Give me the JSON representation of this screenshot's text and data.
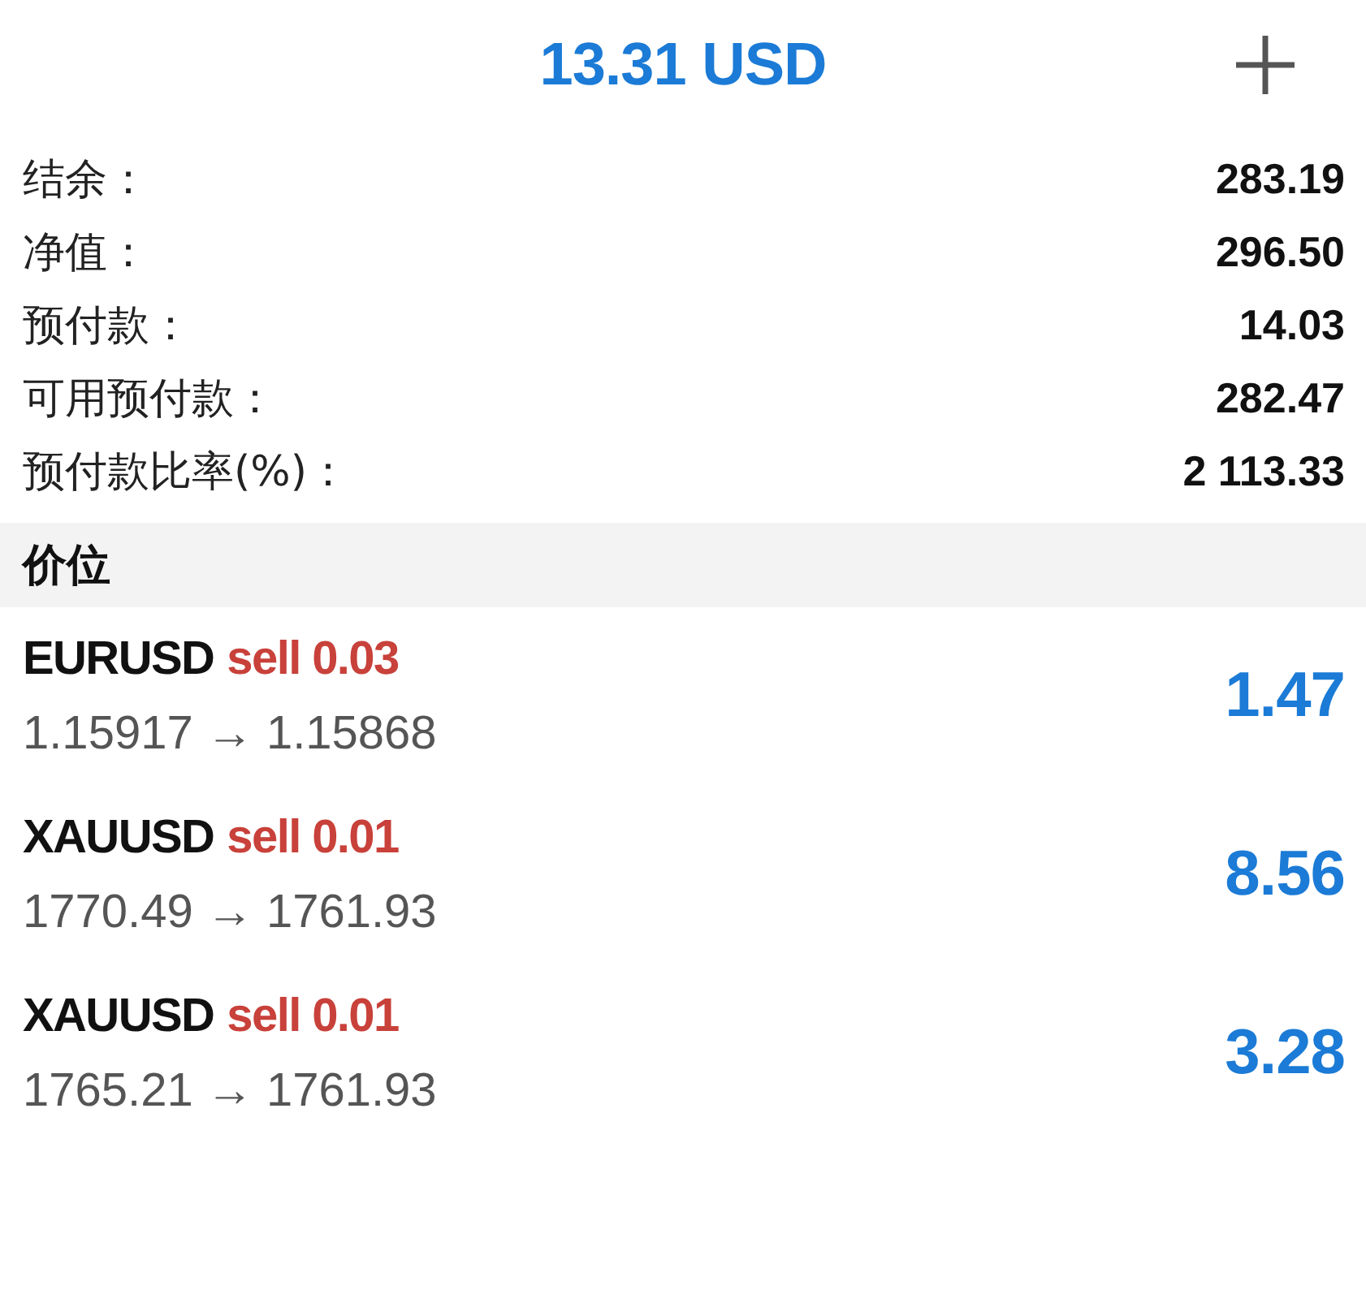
{
  "header": {
    "title": "13.31 USD"
  },
  "summary": [
    {
      "label": "结余：",
      "value": "283.19"
    },
    {
      "label": "净值：",
      "value": "296.50"
    },
    {
      "label": "预付款：",
      "value": "14.03"
    },
    {
      "label": "可用预付款：",
      "value": "282.47"
    },
    {
      "label": "预付款比率(%)：",
      "value": "2 113.33"
    }
  ],
  "positions_section": {
    "title": "价位"
  },
  "positions": [
    {
      "symbol": "EURUSD",
      "order": "sell 0.03",
      "prices": "1.15917 → 1.15868",
      "profit": "1.47"
    },
    {
      "symbol": "XAUUSD",
      "order": "sell 0.01",
      "prices": "1770.49 → 1761.93",
      "profit": "8.56"
    },
    {
      "symbol": "XAUUSD",
      "order": "sell 0.01",
      "prices": "1765.21 → 1761.93",
      "profit": "3.28"
    }
  ]
}
